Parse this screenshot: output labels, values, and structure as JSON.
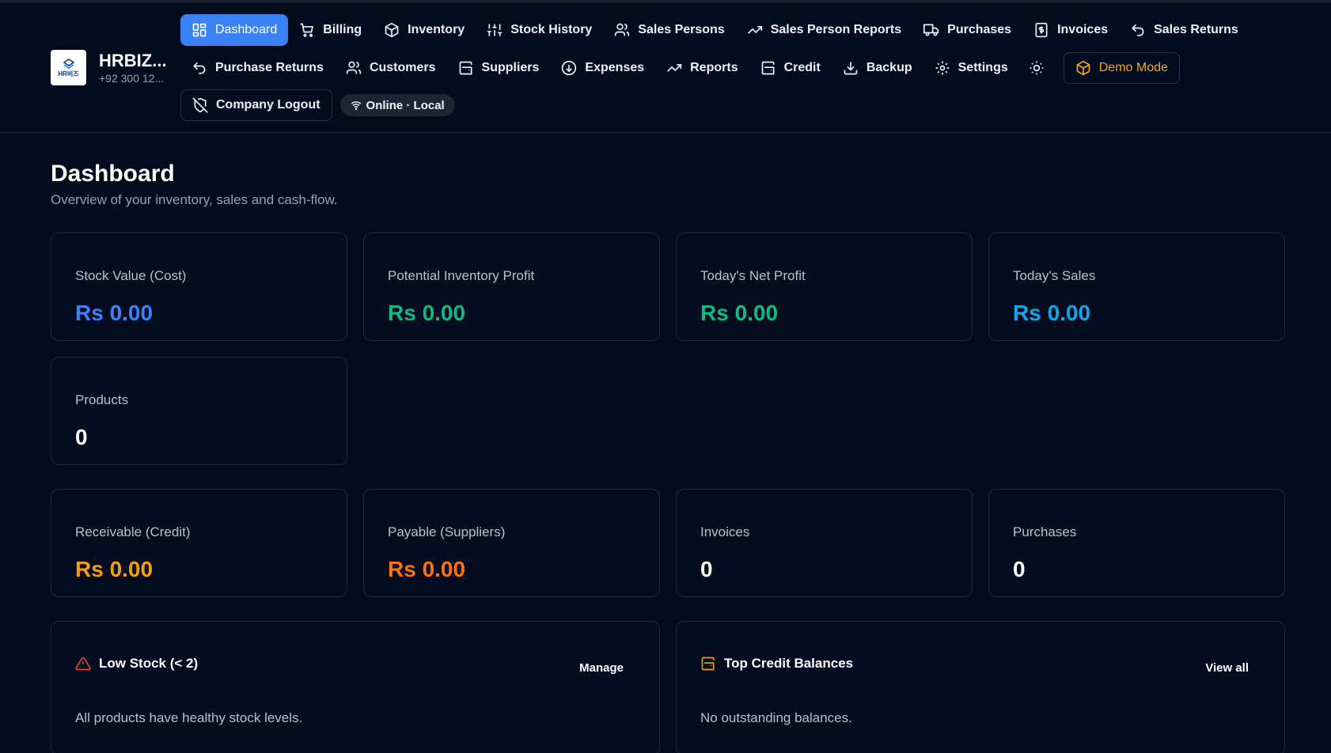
{
  "brand": {
    "name": "HRBIZ...",
    "phone": "+92 300 12...",
    "logo_text": "HR비즈"
  },
  "nav": {
    "row1": [
      {
        "label": "Dashboard",
        "icon": "grid-icon",
        "active": true
      },
      {
        "label": "Billing",
        "icon": "cart-icon"
      },
      {
        "label": "Inventory",
        "icon": "box-icon"
      },
      {
        "label": "Stock History",
        "icon": "sliders-icon"
      },
      {
        "label": "Sales Persons",
        "icon": "users-icon"
      },
      {
        "label": "Sales Person Reports",
        "icon": "trending-up-icon"
      },
      {
        "label": "Purchases",
        "icon": "truck-icon"
      },
      {
        "label": "Invoices",
        "icon": "receipt-icon"
      },
      {
        "label": "Sales Returns",
        "icon": "undo-icon"
      }
    ],
    "row2": [
      {
        "label": "Purchase Returns",
        "icon": "undo-icon"
      },
      {
        "label": "Customers",
        "icon": "users-icon"
      },
      {
        "label": "Suppliers",
        "icon": "wallet-icon"
      },
      {
        "label": "Expenses",
        "icon": "arrow-down-circle-icon"
      },
      {
        "label": "Reports",
        "icon": "trending-up-icon"
      },
      {
        "label": "Credit",
        "icon": "wallet-icon"
      },
      {
        "label": "Backup",
        "icon": "download-icon"
      },
      {
        "label": "Settings",
        "icon": "gear-icon"
      }
    ],
    "theme_toggle_icon": "sun-icon",
    "demo_mode": "Demo Mode",
    "company_logout": "Company Logout",
    "status": "Online · Local"
  },
  "page": {
    "title": "Dashboard",
    "subtitle": "Overview of your inventory, sales and cash-flow."
  },
  "stats": [
    {
      "label": "Stock Value (Cost)",
      "value": "Rs 0.00",
      "color": "#3b82f6"
    },
    {
      "label": "Potential Inventory Profit",
      "value": "Rs 0.00",
      "color": "#10b981"
    },
    {
      "label": "Today's Net Profit",
      "value": "Rs 0.00",
      "color": "#10b981"
    },
    {
      "label": "Today's Sales",
      "value": "Rs 0.00",
      "color": "#0ea5e9"
    },
    {
      "label": "Products",
      "value": "0",
      "color": "#ffffff"
    },
    {
      "label": "Receivable (Credit)",
      "value": "Rs 0.00",
      "color": "#f59e0b"
    },
    {
      "label": "Payable (Suppliers)",
      "value": "Rs 0.00",
      "color": "#f97316"
    },
    {
      "label": "Invoices",
      "value": "0",
      "color": "#ffffff"
    },
    {
      "label": "Purchases",
      "value": "0",
      "color": "#ffffff"
    }
  ],
  "panels": {
    "low_stock": {
      "title": "Low Stock (< 2)",
      "action": "Manage",
      "message": "All products have healthy stock levels.",
      "icon": "warning-icon",
      "icon_color": "#ef4444"
    },
    "credit": {
      "title": "Top Credit Balances",
      "action": "View all",
      "message": "No outstanding balances.",
      "icon": "wallet-icon",
      "icon_color": "#f59e0b"
    }
  }
}
